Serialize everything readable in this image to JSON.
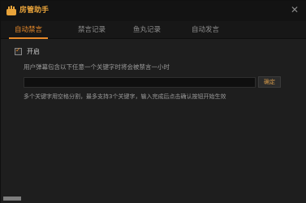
{
  "window": {
    "title": "房管助手",
    "close_glyph": "✕",
    "icons": {
      "logo": "brand-logo-icon",
      "close": "close-icon"
    },
    "colors": {
      "accent": "#e88a2a",
      "title": "#e8a33a",
      "background": "#1e1e1e"
    }
  },
  "tabs": [
    {
      "label": "自动禁言",
      "active": true
    },
    {
      "label": "禁言记录",
      "active": false
    },
    {
      "label": "鱼丸记录",
      "active": false
    },
    {
      "label": "自动发言",
      "active": false
    }
  ],
  "auto_mute": {
    "enable_label": "开启",
    "enabled": true,
    "description": "用户弹幕包含以下任意一个关键字时将会被禁言一小时",
    "keyword_value": "",
    "keyword_placeholder": "",
    "confirm_label": "确定",
    "hint": "多个关键字用空格分割，最多支持3个关键字，输入完成后点击确认按钮开始生效"
  }
}
